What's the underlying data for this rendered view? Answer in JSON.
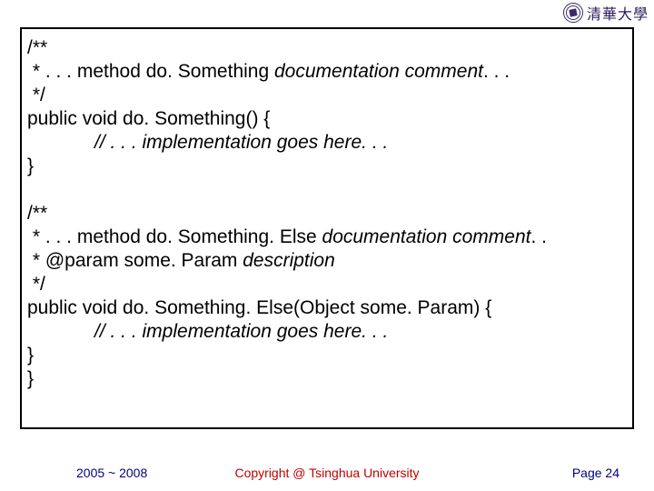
{
  "logo": {
    "text": "清華大學"
  },
  "code": {
    "l1": "/**",
    "l2_a": " * . . . method do. Something ",
    "l2_b": "documentation comment",
    "l2_c": ". . .",
    "l3": " */",
    "l4": "public void do. Something() {",
    "l5": "// . . . implementation goes here. . .",
    "l6": "}",
    "l7": " ",
    "l8": "/**",
    "l9_a": " * . . . method do. Something. Else ",
    "l9_b": "documentation comment",
    "l9_c": ". .",
    "l10_a": " * @param some. Param ",
    "l10_b": "description",
    "l11": " */",
    "l12": "public void do. Something. Else(Object some. Param) {",
    "l13": "// . . . implementation goes here. . .",
    "l14": "}",
    "l15": "}"
  },
  "footer": {
    "left": "2005 ~ 2008",
    "center": "Copyright @ Tsinghua University",
    "right": "Page 24"
  }
}
